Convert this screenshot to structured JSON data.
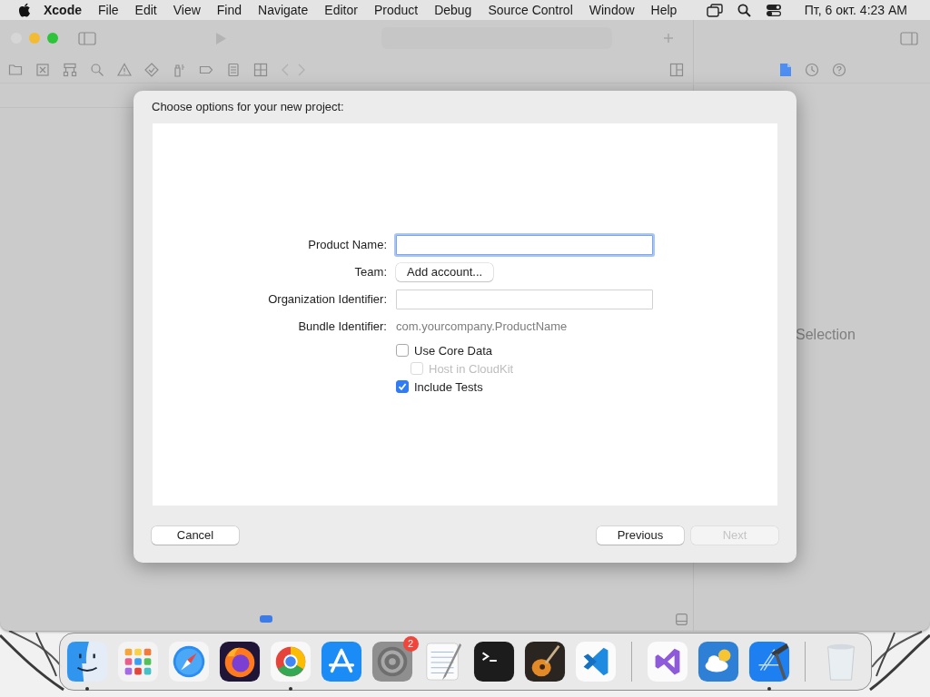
{
  "menu_bar": {
    "app": "Xcode",
    "items": [
      "File",
      "Edit",
      "View",
      "Find",
      "Navigate",
      "Editor",
      "Product",
      "Debug",
      "Source Control",
      "Window",
      "Help"
    ],
    "clock": "Пт, 6 окт. 4:23 AM"
  },
  "inspector": {
    "placeholder_text": "Selection"
  },
  "dialog": {
    "title": "Choose options for your new project:",
    "fields": [
      {
        "kind": "text",
        "label": "Product Name:",
        "focused": true
      },
      {
        "kind": "button",
        "label": "Team:",
        "button": "Add account..."
      },
      {
        "kind": "text",
        "label": "Organization Identifier:",
        "focused": false
      },
      {
        "kind": "static",
        "label": "Bundle Identifier:",
        "value": "com.yourcompany.ProductName"
      }
    ],
    "options": [
      {
        "label": "Use Core Data",
        "checked": false,
        "disabled": false,
        "children": [
          {
            "label": "Host in CloudKit",
            "checked": false,
            "disabled": true
          }
        ]
      },
      {
        "label": "Include Tests",
        "checked": true,
        "disabled": false
      }
    ],
    "buttons": [
      {
        "label": "Cancel",
        "disabled": false
      },
      {
        "label": "Previous",
        "disabled": false
      },
      {
        "label": "Next",
        "disabled": true
      }
    ]
  },
  "dock": [
    {
      "items": [
        {
          "kind": "face",
          "running": true
        },
        {
          "kind": "grid",
          "running": false
        },
        {
          "kind": "compass",
          "running": false
        },
        {
          "kind": "fox",
          "running": false
        },
        {
          "kind": "wheel",
          "running": true
        },
        {
          "kind": "a-mark",
          "running": false
        },
        {
          "kind": "gear",
          "running": false,
          "badge": "2"
        },
        {
          "kind": "notepad",
          "running": false
        },
        {
          "kind": "terminal",
          "running": false
        },
        {
          "kind": "guitar",
          "running": false
        },
        {
          "kind": "bracket",
          "running": false
        }
      ]
    },
    {
      "items": [
        {
          "kind": "loop",
          "running": false
        },
        {
          "kind": "cloud",
          "running": false
        },
        {
          "kind": "hammer",
          "running": true
        }
      ]
    },
    {
      "items": [
        {
          "kind": "bin",
          "running": false
        }
      ]
    }
  ]
}
